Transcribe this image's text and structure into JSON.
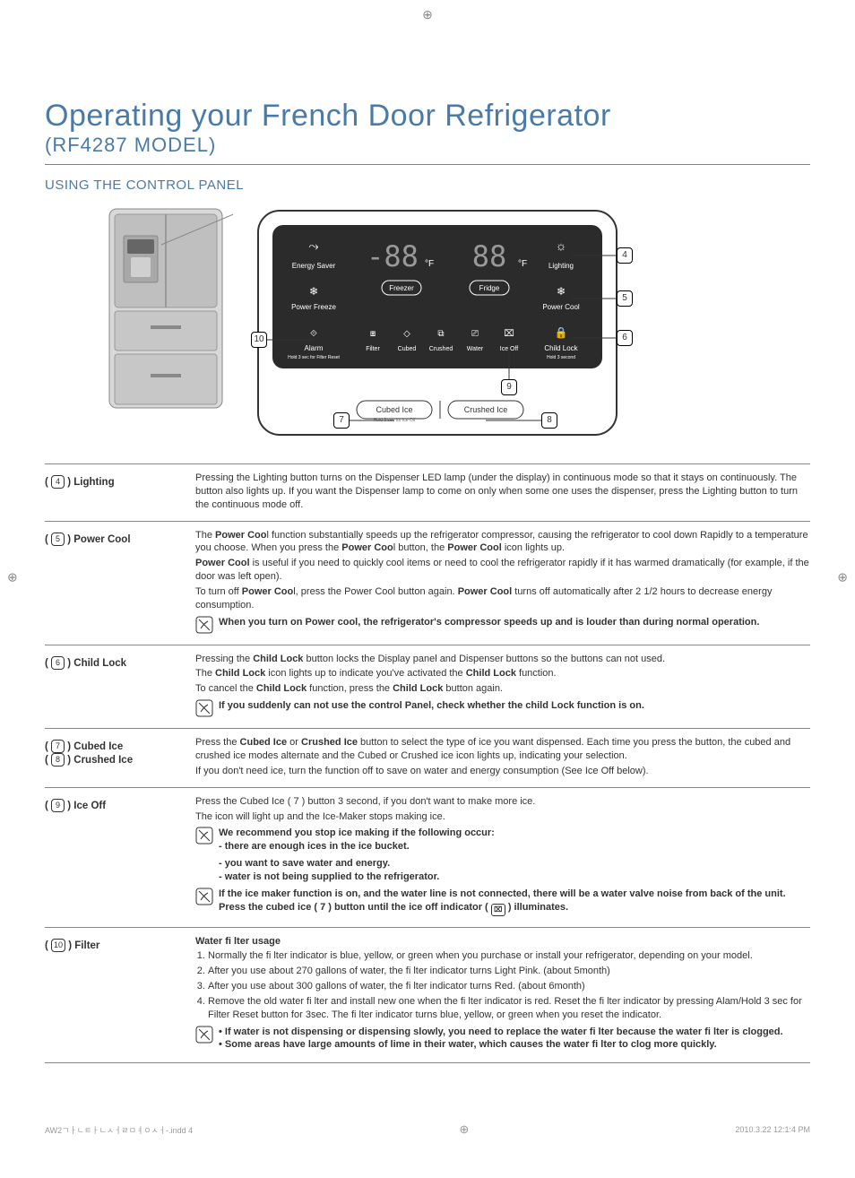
{
  "header": {
    "title": "Operating your French Door Refrigerator",
    "model": "(RF4287 MODEL)",
    "section": "USING THE CONTROL PANEL"
  },
  "panel_labels": {
    "energy_saver": "Energy Saver",
    "lighting": "Lighting",
    "power_freeze": "Power Freeze",
    "power_cool": "Power Cool",
    "alarm": "Alarm",
    "alarm_sub": "Hold 3 sec for Filter Reset",
    "filter": "Filter",
    "cubed": "Cubed",
    "crushed": "Crushed",
    "water": "Water",
    "ice_off": "Ice Off",
    "child_lock": "Child Lock",
    "child_lock_sub": "Hold 3 second",
    "freezer_btn": "Freezer",
    "fridge_btn": "Fridge",
    "cubed_ice_btn": "Cubed Ice",
    "cubed_ice_sub": "Hold 3 sec for Ice Off",
    "crushed_ice_btn": "Crushed Ice",
    "deg_f": "°F"
  },
  "callouts": {
    "c4": "4",
    "c5": "5",
    "c6": "6",
    "c7": "7",
    "c8": "8",
    "c9": "9",
    "c10": "10"
  },
  "rows": {
    "lighting": {
      "key_num": "4",
      "key_label": "Lighting",
      "text": "Pressing the Lighting button turns on the Dispenser LED lamp (under the display) in continuous mode so that it stays on continuously. The button also lights up. If you want the Dispenser lamp to come on only when some one uses the dispenser, press the Lighting button to turn the continuous mode off."
    },
    "power_cool": {
      "key_num": "5",
      "key_label": "Power Cool",
      "p1a": "The ",
      "p1b": "Power Coo",
      "p1c": "l function substantially speeds up the refrigerator compressor, causing the refrigerator to cool down Rapidly to a temperature you choose. When you press the ",
      "p1d": "Power Coo",
      "p1e": "l button, the ",
      "p1f": "Power Cool",
      "p1g": " icon lights up.",
      "p2a": "Power Cool",
      "p2b": " is useful if you need to quickly cool items or need to cool the refrigerator rapidly if it has warmed dramatically (for example, if the door was left open).",
      "p3a": "To turn off ",
      "p3b": "Power Coo",
      "p3c": "l, press the Power Cool button again. ",
      "p3d": "Power Cool",
      "p3e": " turns off automatically after 2 1/2 hours to decrease energy consumption.",
      "note": "When you turn on Power cool, the refrigerator's compressor speeds up and is louder than during normal operation."
    },
    "child_lock": {
      "key_num": "6",
      "key_label": "Child Lock",
      "p1a": "Pressing the ",
      "p1b": "Child Lock",
      "p1c": " button locks the Display panel and Dispenser buttons so the buttons can not used.",
      "p2a": "The ",
      "p2b": "Child Lock",
      "p2c": " icon lights up to indicate you've activated the ",
      "p2d": "Child Lock",
      "p2e": " function.",
      "p3a": "To cancel the ",
      "p3b": "Child Lock",
      "p3c": " function, press the ",
      "p3d": "Child Lock",
      "p3e": " button again.",
      "note": "If you suddenly can not use the control Panel, check whether the child Lock function is on."
    },
    "ice_type": {
      "key_num_a": "7",
      "key_label_a": "Cubed Ice",
      "key_num_b": "8",
      "key_label_b": "Crushed Ice",
      "p1a": "Press the ",
      "p1b": "Cubed Ice",
      "p1c": " or ",
      "p1d": "Crushed Ice",
      "p1e": " button to select the type of ice you want dispensed. Each time you press the button, the cubed and crushed ice modes alternate and the Cubed or Crushed ice icon lights up, indicating your selection.",
      "p2": "If you don't need ice, turn the function off to save on water and energy consumption (See Ice Off below)."
    },
    "ice_off": {
      "key_num": "9",
      "key_label": "Ice Off",
      "p1": "Press the Cubed Ice ( 7 ) button 3 second, if you don't want to make more ice.",
      "p2": "The icon will light up and the Ice-Maker stops making ice.",
      "note1_l1": "We recommend you stop ice making if the following occur:",
      "note1_l2": "- there are enough ices in the ice bucket.",
      "note1_l3": "- you want to save water and energy.",
      "note1_l4": "- water is not being supplied to the refrigerator.",
      "note2": "If the ice maker function is on, and the water line is not connected, there will be a water valve noise from back of the unit. Press the cubed ice ( 7 ) button until the ice off indicator ( ",
      "note2_suffix": " ) illuminates."
    },
    "filter": {
      "key_num": "10",
      "key_label": "Filter",
      "heading": "Water fi lter usage",
      "li1": "Normally the fi lter indicator is blue, yellow, or green when you purchase or install your refrigerator, depending on your model.",
      "li2": "After you use about 270 gallons of water, the fi lter indicator turns Light Pink. (about 5month)",
      "li3": "After you use about 300 gallons of water, the fi lter indicator turns Red. (about 6month)",
      "li4": "Remove the old water fi lter and install new one when the fi lter indicator is red. Reset the fi lter indicator by pressing Alam/Hold 3 sec for Filter Reset button for 3sec. The fi lter indicator turns blue, yellow, or green when you reset the indicator.",
      "note_b1": "• If water is not dispensing or dispensing slowly, you need to replace the water fi lter because the water fi lter is clogged.",
      "note_b2": "• Some areas have large amounts of lime in their water, which causes the water fi lter to clog more quickly."
    }
  },
  "footer": {
    "left": "AW2ㄱㅏㄴㅌㅏㄴㅅㅓㄹㅁㅕㅇㅅㅓ-.indd   4",
    "right": "2010.3.22   12:1:4 PM"
  }
}
